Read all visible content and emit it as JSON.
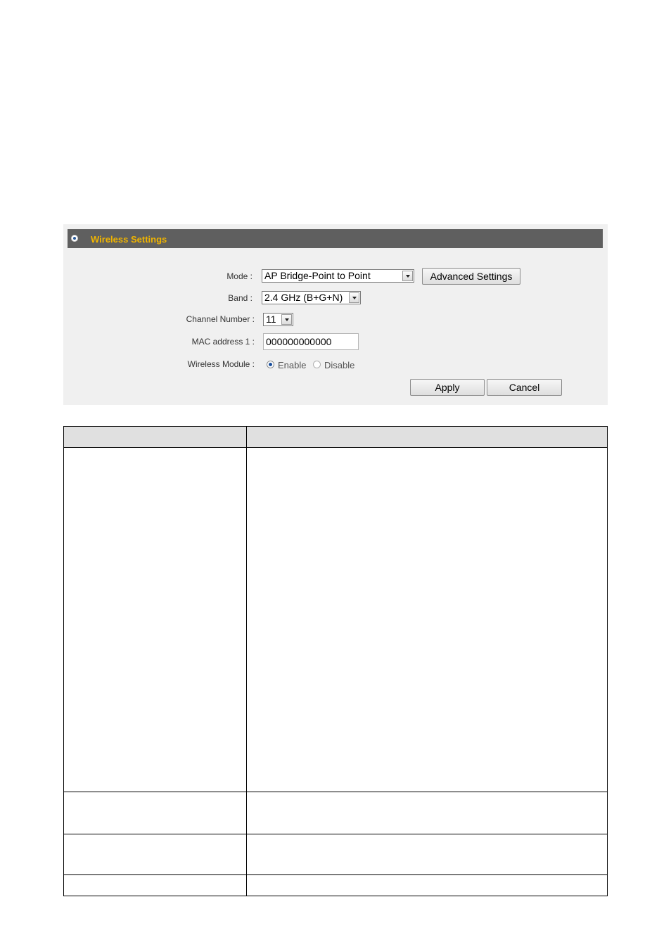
{
  "panel": {
    "title": "Wireless Settings",
    "mode": {
      "label": "Mode :",
      "value": "AP Bridge-Point to Point"
    },
    "advanced_button": "Advanced Settings",
    "band": {
      "label": "Band :",
      "value": "2.4 GHz (B+G+N)"
    },
    "channel": {
      "label": "Channel Number :",
      "value": "11"
    },
    "mac": {
      "label": "MAC address 1 :",
      "value": "000000000000"
    },
    "module": {
      "label": "Wireless Module :",
      "options": [
        {
          "label": "Enable",
          "checked": true
        },
        {
          "label": "Disable",
          "checked": false
        }
      ]
    },
    "apply_button": "Apply",
    "cancel_button": "Cancel"
  },
  "colors": {
    "header_bg": "#5f5f5f",
    "header_text": "#f0b400",
    "panel_bg": "#f0f0f0",
    "table_head_bg": "#e0e0e0"
  }
}
